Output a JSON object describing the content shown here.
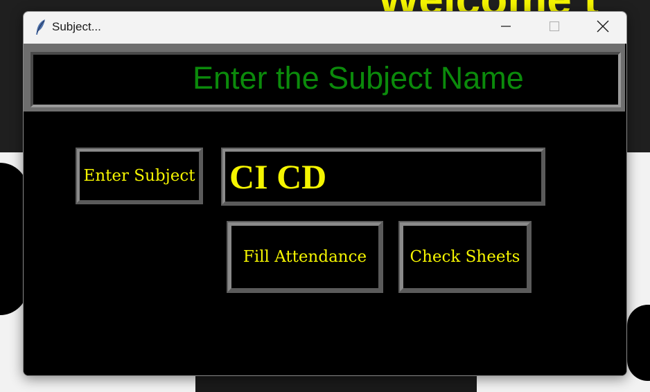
{
  "background": {
    "heading_fragment": "Welcome t",
    "accent_color": "#f5f500"
  },
  "window": {
    "title": "Subject...",
    "icon": "feather-icon",
    "controls": {
      "minimize": "minimize-icon",
      "maximize": "maximize-icon",
      "close": "close-icon"
    }
  },
  "header": {
    "title": "Enter the Subject Name",
    "title_color": "#0b8a0b"
  },
  "form": {
    "subject_label": "Enter Subject",
    "subject_value": "CI CD",
    "text_color": "#f5f500"
  },
  "buttons": {
    "fill_attendance": "Fill Attendance",
    "check_sheets": "Check Sheets"
  }
}
